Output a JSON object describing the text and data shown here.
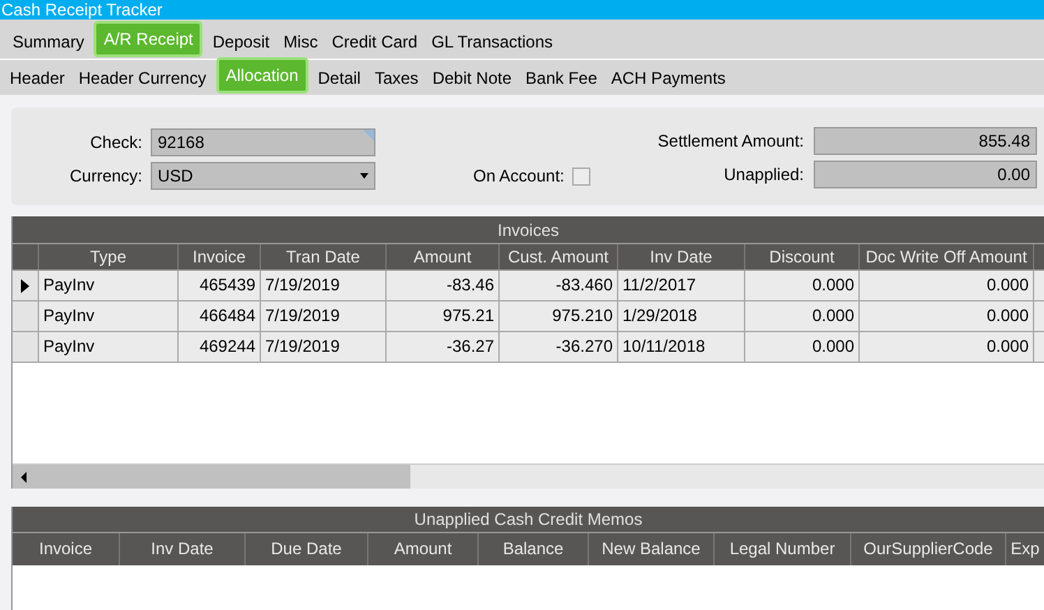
{
  "window": {
    "title": "Cash Receipt Tracker"
  },
  "tabs": [
    {
      "label": "Summary",
      "selected": false
    },
    {
      "label": "A/R Receipt",
      "selected": true
    },
    {
      "label": "Deposit",
      "selected": false
    },
    {
      "label": "Misc",
      "selected": false
    },
    {
      "label": "Credit Card",
      "selected": false
    },
    {
      "label": "GL Transactions",
      "selected": false
    }
  ],
  "subtabs": [
    {
      "label": "Header",
      "selected": false
    },
    {
      "label": "Header Currency",
      "selected": false
    },
    {
      "label": "Allocation",
      "selected": true
    },
    {
      "label": "Detail",
      "selected": false
    },
    {
      "label": "Taxes",
      "selected": false
    },
    {
      "label": "Debit Note",
      "selected": false
    },
    {
      "label": "Bank Fee",
      "selected": false
    },
    {
      "label": "ACH Payments",
      "selected": false
    }
  ],
  "form": {
    "check": {
      "label": "Check:",
      "value": "92168"
    },
    "currency": {
      "label": "Currency:",
      "value": "USD"
    },
    "on_account": {
      "label": "On Account:",
      "checked": false
    },
    "settlement_amount": {
      "label": "Settlement Amount:",
      "value": "855.48"
    },
    "unapplied": {
      "label": "Unapplied:",
      "value": "0.00"
    }
  },
  "invoices": {
    "title": "Invoices",
    "columns": [
      "Type",
      "Invoice",
      "Tran Date",
      "Amount",
      "Cust. Amount",
      "Inv Date",
      "Discount",
      "Doc Write Off Amount"
    ],
    "rows": [
      {
        "selected": true,
        "cells": [
          "PayInv",
          "465439",
          "7/19/2019",
          "-83.46",
          "-83.460",
          "11/2/2017",
          "0.000",
          "0.000"
        ]
      },
      {
        "selected": false,
        "cells": [
          "PayInv",
          "466484",
          "7/19/2019",
          "975.21",
          "975.210",
          "1/29/2018",
          "0.000",
          "0.000"
        ]
      },
      {
        "selected": false,
        "cells": [
          "PayInv",
          "469244",
          "7/19/2019",
          "-36.27",
          "-36.270",
          "10/11/2018",
          "0.000",
          "0.000"
        ]
      }
    ]
  },
  "memos": {
    "title": "Unapplied Cash Credit Memos",
    "columns": [
      "Invoice",
      "Inv Date",
      "Due Date",
      "Amount",
      "Balance",
      "New Balance",
      "Legal Number",
      "OurSupplierCode",
      "Exp"
    ]
  }
}
